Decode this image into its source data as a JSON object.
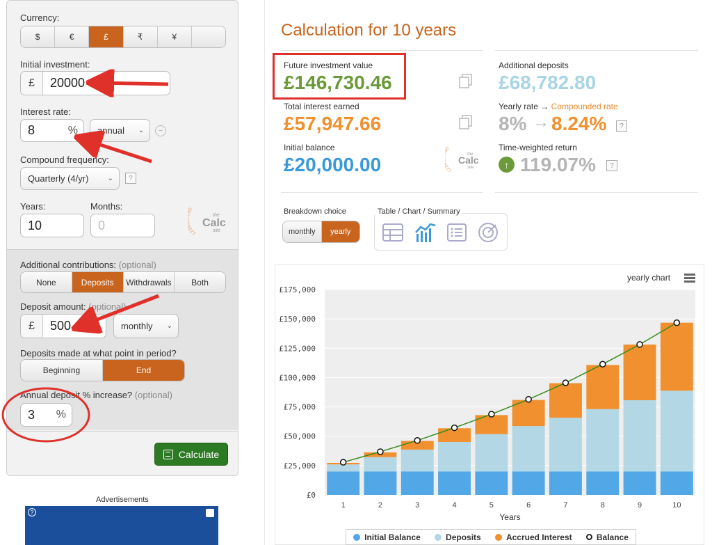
{
  "left": {
    "currency_label": "Currency:",
    "currencies": [
      "$",
      "€",
      "£",
      "₹",
      "¥",
      ""
    ],
    "initial_label": "Initial investment:",
    "currency_symbol": "£",
    "initial_value": "20000",
    "rate_label": "Interest rate:",
    "rate_value": "8",
    "rate_suffix": "%",
    "rate_period": "annual",
    "compound_label": "Compound frequency:",
    "compound_value": "Quarterly (4/yr)",
    "years_label": "Years:",
    "months_label": "Months:",
    "years_value": "10",
    "months_placeholder": "0",
    "logo_numbers": "1234567890",
    "logo_the": "the",
    "logo_calc": "Calc",
    "logo_site": "site",
    "contrib_label": "Additional contributions:",
    "optional": "(optional)",
    "contrib_options": [
      "None",
      "Deposits",
      "Withdrawals",
      "Both"
    ],
    "deposit_label": "Deposit amount:",
    "deposit_value": "500",
    "deposit_period": "monthly",
    "point_label": "Deposits made at what point in period?",
    "point_options": [
      "Beginning",
      "End"
    ],
    "increase_label": "Annual deposit % increase?",
    "increase_value": "3",
    "increase_suffix": "%",
    "calculate": "Calculate",
    "help": "?"
  },
  "ads": {
    "label": "Advertisements"
  },
  "results": {
    "title": "Calculation for 10 years",
    "future_label": "Future investment value",
    "future_value": "£146,730.46",
    "interest_label": "Total interest earned",
    "interest_value": "£57,947.66",
    "initial_label": "Initial balance",
    "initial_value": "£20,000.00",
    "additional_label": "Additional deposits",
    "additional_value": "£68,782.80",
    "yearly_rate_label": "Yearly rate →",
    "compounded_label": "Compounded rate",
    "yearly_rate": "8%",
    "arrow": "→",
    "compounded_rate": "8.24%",
    "twr_label": "Time-weighted return",
    "twr_value": "119.07%",
    "breakdown_label": "Breakdown choice",
    "breakdown_options": [
      "monthly",
      "yearly"
    ],
    "view_label": "Table / Chart / Summary",
    "chart_menu_label": "yearly chart"
  },
  "colors": {
    "orange": "#c8641e",
    "green": "#6a9a3a",
    "interest_orange": "#f0902e",
    "initial_blue": "#3a9ad9",
    "additional_lightblue": "#a8d4e4",
    "grey": "#b5b5b5"
  },
  "chart_data": {
    "type": "bar",
    "stacked": true,
    "categories": [
      "1",
      "2",
      "3",
      "4",
      "5",
      "6",
      "7",
      "8",
      "9",
      "10"
    ],
    "xlabel": "Years",
    "ylabel": "",
    "ylim": [
      0,
      175000
    ],
    "yticks": [
      "£0",
      "£25,000",
      "£50,000",
      "£75,000",
      "£100,000",
      "£125,000",
      "£150,000",
      "£175,000"
    ],
    "series": [
      {
        "name": "Initial Balance",
        "color": "#52a8e6",
        "values": [
          20000,
          20000,
          20000,
          20000,
          20000,
          20000,
          20000,
          20000,
          20000,
          20000
        ]
      },
      {
        "name": "Deposits",
        "color": "#b3d7e4",
        "values": [
          6000,
          12200,
          18600,
          25100,
          31800,
          38700,
          45800,
          53100,
          60700,
          68783
        ]
      },
      {
        "name": "Accrued Interest",
        "color": "#f0902e",
        "values": [
          1300,
          4000,
          7400,
          11700,
          16200,
          22200,
          29400,
          37600,
          47400,
          57948
        ]
      }
    ],
    "line": {
      "name": "Balance",
      "color": "#3a8a1e",
      "values": [
        27800,
        36800,
        46400,
        57200,
        68800,
        81400,
        95500,
        111400,
        128200,
        146730
      ]
    },
    "grid": true,
    "legend": "bottom"
  }
}
